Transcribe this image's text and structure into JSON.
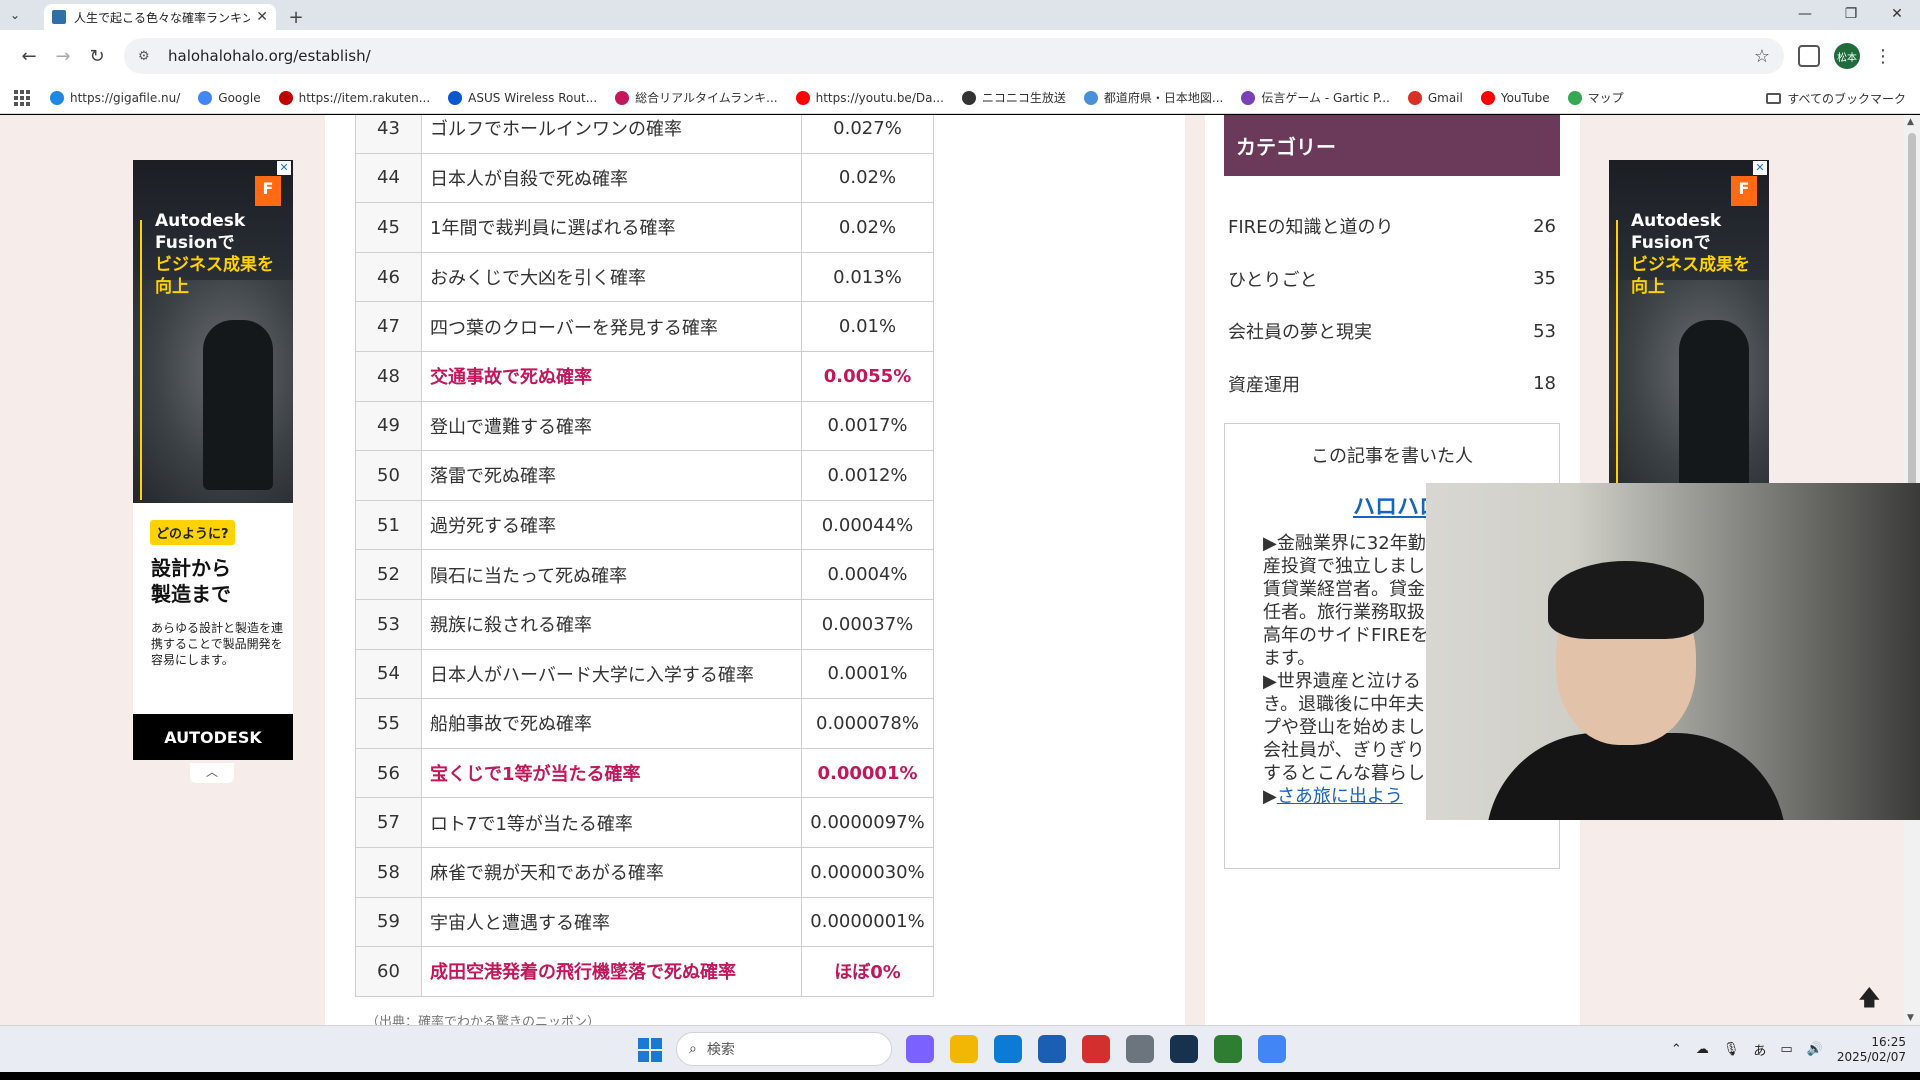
{
  "browser": {
    "tab_title": "人生で起こる色々な確率ランキング",
    "url": "halohalohalo.org/establish/",
    "bookmarks": [
      {
        "label": "https://gigafile.nu/",
        "color": "#1e88e5"
      },
      {
        "label": "Google",
        "color": "#4285f4"
      },
      {
        "label": "https://item.rakuten...",
        "color": "#bf0000"
      },
      {
        "label": "ASUS Wireless Rout...",
        "color": "#0b57d0"
      },
      {
        "label": "総合リアルタイムランキ...",
        "color": "#c2185b"
      },
      {
        "label": "https://youtu.be/Da...",
        "color": "#ff0000"
      },
      {
        "label": "ニコニコ生放送",
        "color": "#333333"
      },
      {
        "label": "都道府県・日本地図...",
        "color": "#4a90d9"
      },
      {
        "label": "伝言ゲーム - Gartic P...",
        "color": "#7b3fb6"
      },
      {
        "label": "Gmail",
        "color": "#d93025"
      },
      {
        "label": "YouTube",
        "color": "#ff0000"
      },
      {
        "label": "マップ",
        "color": "#34a853"
      }
    ],
    "all_bookmarks": "すべてのブックマーク",
    "profile_label": "松本"
  },
  "table": {
    "rows": [
      {
        "rank": "43",
        "name": "ゴルフでホールインワンの確率",
        "value": "0.027%",
        "highlight": false
      },
      {
        "rank": "44",
        "name": "日本人が自殺で死ぬ確率",
        "value": "0.02%",
        "highlight": false
      },
      {
        "rank": "45",
        "name": "1年間で裁判員に選ばれる確率",
        "value": "0.02%",
        "highlight": false
      },
      {
        "rank": "46",
        "name": "おみくじで大凶を引く確率",
        "value": "0.013%",
        "highlight": false
      },
      {
        "rank": "47",
        "name": "四つ葉のクローバーを発見する確率",
        "value": "0.01%",
        "highlight": false
      },
      {
        "rank": "48",
        "name": "交通事故で死ぬ確率",
        "value": "0.0055%",
        "highlight": true
      },
      {
        "rank": "49",
        "name": "登山で遭難する確率",
        "value": "0.0017%",
        "highlight": false
      },
      {
        "rank": "50",
        "name": "落雷で死ぬ確率",
        "value": "0.0012%",
        "highlight": false
      },
      {
        "rank": "51",
        "name": "過労死する確率",
        "value": "0.00044%",
        "highlight": false
      },
      {
        "rank": "52",
        "name": "隕石に当たって死ぬ確率",
        "value": "0.0004%",
        "highlight": false
      },
      {
        "rank": "53",
        "name": "親族に殺される確率",
        "value": "0.00037%",
        "highlight": false
      },
      {
        "rank": "54",
        "name": "日本人がハーバード大学に入学する確率",
        "value": "0.0001%",
        "highlight": false
      },
      {
        "rank": "55",
        "name": "船舶事故で死ぬ確率",
        "value": "0.000078%",
        "highlight": false
      },
      {
        "rank": "56",
        "name": "宝くじで1等が当たる確率",
        "value": "0.00001%",
        "highlight": true
      },
      {
        "rank": "57",
        "name": "ロト7で1等が当たる確率",
        "value": "0.0000097%",
        "highlight": false
      },
      {
        "rank": "58",
        "name": "麻雀で親が天和であがる確率",
        "value": "0.0000030%",
        "highlight": false
      },
      {
        "rank": "59",
        "name": "宇宙人と遭遇する確率",
        "value": "0.0000001%",
        "highlight": false
      },
      {
        "rank": "60",
        "name": "成田空港発着の飛行機墜落で死ぬ確率",
        "value": "ほぼ0%",
        "highlight": true
      }
    ],
    "source": "（出典：確率でわかる驚きのニッポン）"
  },
  "sidebar": {
    "category_header": "カテゴリー",
    "categories": [
      {
        "label": "FIREの知識と道のり",
        "count": "26"
      },
      {
        "label": "ひとりごと",
        "count": "35"
      },
      {
        "label": "会社員の夢と現実",
        "count": "53"
      },
      {
        "label": "資産運用",
        "count": "18"
      }
    ],
    "author": {
      "title": "この記事を書いた人",
      "name": "ハロハロ",
      "lines": [
        "▶金融業界に32年勤",
        "産投資で独立しまし",
        "賃貸業経営者。貸金",
        "任者。旅行業務取扱",
        "高年のサイドFIREを",
        "ます。",
        "▶世界遺産と泣ける",
        "き。退職後に中年夫",
        "プや登山を始めまし",
        "会社員が、ぎりぎり",
        "するとこんな暮らし"
      ],
      "link_prefix": "▶",
      "link_text": "さあ旅に出よう"
    }
  },
  "ad": {
    "headline_1": "Autodesk Fusionで",
    "headline_2": "ビジネス成果を向上",
    "badge": "どのように?",
    "big_1": "設計から",
    "big_2": "製造まで",
    "small": "あらゆる設計と製造を連携することで製品開発を容易にします。",
    "brand": "AUTODESK",
    "logo_letter": "F",
    "close": "✕"
  },
  "taskbar": {
    "search_placeholder": "検索",
    "ime": "あ",
    "time": "16:25",
    "date": "2025/02/07",
    "apps": [
      "#7b61ff",
      "#f2b705",
      "#0c7bd6",
      "#1b5fb5",
      "#d32f2f",
      "#6c757d",
      "#16324f",
      "#2e7d32",
      "#4285f4"
    ]
  }
}
